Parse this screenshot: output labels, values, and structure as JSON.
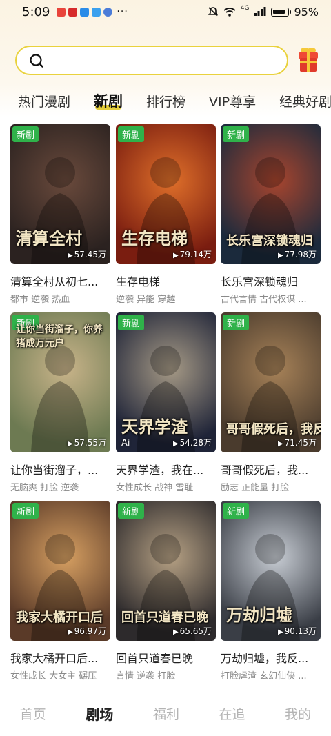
{
  "status_bar": {
    "time": "5:09",
    "signal_label": "4G",
    "battery_pct": "95%",
    "overflow": "···"
  },
  "search": {
    "placeholder": "",
    "value": ""
  },
  "tabs": [
    {
      "label": "热门漫剧",
      "active": false
    },
    {
      "label": "新剧",
      "active": true
    },
    {
      "label": "排行榜",
      "active": false
    },
    {
      "label": "VIP尊享",
      "active": false
    },
    {
      "label": "经典好剧",
      "active": false
    }
  ],
  "badge_label": "新剧",
  "dramas": [
    {
      "cover_title": "清算全村",
      "views": "57.45万",
      "title": "清算全村从初七...",
      "tags": "都市 逆袭 热血",
      "colors": [
        "#2b2220",
        "#6a4a3c"
      ]
    },
    {
      "cover_title": "生存电梯",
      "views": "79.14万",
      "title": "生存电梯",
      "tags": "逆袭 异能 穿越",
      "colors": [
        "#7a1d10",
        "#e0702a"
      ]
    },
    {
      "cover_title": "长乐宫深锁魂归",
      "views": "77.98万",
      "title": "长乐宫深锁魂归",
      "tags": "古代言情 古代权谋 ...",
      "colors": [
        "#1b2a3c",
        "#a8452e"
      ]
    },
    {
      "cover_title": "让你当街溜子，你养猪成万元户",
      "views": "57.55万",
      "title": "让你当街溜子，...",
      "tags": "无脑爽 打脸 逆袭",
      "colors": [
        "#6d7a52",
        "#c9b48a"
      ]
    },
    {
      "cover_title": "天界学渣",
      "views": "54.28万",
      "title": "天界学渣，我在...",
      "tags": "女性成长 战神 雪耻",
      "colors": [
        "#1f2438",
        "#a69a86"
      ],
      "ai": "Ai"
    },
    {
      "cover_title": "哥哥假死后，我反",
      "views": "71.45万",
      "title": "哥哥假死后，我...",
      "tags": "励志 正能量 打脸",
      "colors": [
        "#4a3b2d",
        "#a78258"
      ]
    },
    {
      "cover_title": "我家大橘开口后",
      "views": "96.97万",
      "title": "我家大橘开口后...",
      "tags": "女性成长 大女主 碾压",
      "colors": [
        "#5a3a28",
        "#d7a062"
      ]
    },
    {
      "cover_title": "回首只道春已晚",
      "views": "65.65万",
      "title": "回首只道春已晚",
      "tags": "言情 逆袭 打脸",
      "colors": [
        "#2d2a2c",
        "#b6a184"
      ]
    },
    {
      "cover_title": "万劫归墟",
      "views": "90.13万",
      "title": "万劫归墟，我反...",
      "tags": "打脸虐渣 玄幻仙侠 ...",
      "colors": [
        "#3a3e46",
        "#c8cdd4"
      ]
    }
  ],
  "bottom_nav": [
    {
      "label": "首页",
      "active": false
    },
    {
      "label": "剧场",
      "active": true
    },
    {
      "label": "福利",
      "active": false
    },
    {
      "label": "在追",
      "active": false
    },
    {
      "label": "我的",
      "active": false
    }
  ],
  "colors": {
    "accent_yellow": "#e9d23d",
    "badge_green": "#2fb24a",
    "gift_red": "#e03a2c"
  }
}
